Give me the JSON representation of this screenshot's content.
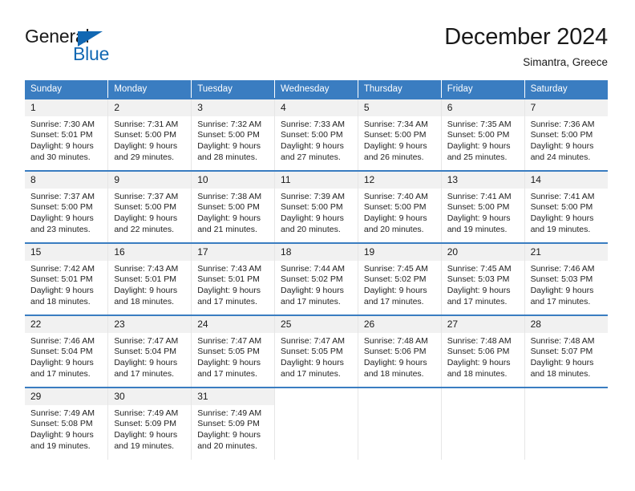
{
  "logo": {
    "word_one": "General",
    "word_two": "Blue",
    "triangle_color": "#1268b3",
    "text_color": "#1a1a1a"
  },
  "header": {
    "title": "December 2024",
    "subtitle": "Simantra, Greece"
  },
  "theme": {
    "header_bg": "#3a7dc1",
    "header_text": "#ffffff",
    "daynum_bg": "#f1f1f1",
    "row_divider": "#3a7dc1",
    "col_divider": "#e6e6e6"
  },
  "weekdays": [
    "Sunday",
    "Monday",
    "Tuesday",
    "Wednesday",
    "Thursday",
    "Friday",
    "Saturday"
  ],
  "weeks": [
    [
      {
        "day": "1",
        "sunrise": "Sunrise: 7:30 AM",
        "sunset": "Sunset: 5:01 PM",
        "daylight_1": "Daylight: 9 hours",
        "daylight_2": "and 30 minutes."
      },
      {
        "day": "2",
        "sunrise": "Sunrise: 7:31 AM",
        "sunset": "Sunset: 5:00 PM",
        "daylight_1": "Daylight: 9 hours",
        "daylight_2": "and 29 minutes."
      },
      {
        "day": "3",
        "sunrise": "Sunrise: 7:32 AM",
        "sunset": "Sunset: 5:00 PM",
        "daylight_1": "Daylight: 9 hours",
        "daylight_2": "and 28 minutes."
      },
      {
        "day": "4",
        "sunrise": "Sunrise: 7:33 AM",
        "sunset": "Sunset: 5:00 PM",
        "daylight_1": "Daylight: 9 hours",
        "daylight_2": "and 27 minutes."
      },
      {
        "day": "5",
        "sunrise": "Sunrise: 7:34 AM",
        "sunset": "Sunset: 5:00 PM",
        "daylight_1": "Daylight: 9 hours",
        "daylight_2": "and 26 minutes."
      },
      {
        "day": "6",
        "sunrise": "Sunrise: 7:35 AM",
        "sunset": "Sunset: 5:00 PM",
        "daylight_1": "Daylight: 9 hours",
        "daylight_2": "and 25 minutes."
      },
      {
        "day": "7",
        "sunrise": "Sunrise: 7:36 AM",
        "sunset": "Sunset: 5:00 PM",
        "daylight_1": "Daylight: 9 hours",
        "daylight_2": "and 24 minutes."
      }
    ],
    [
      {
        "day": "8",
        "sunrise": "Sunrise: 7:37 AM",
        "sunset": "Sunset: 5:00 PM",
        "daylight_1": "Daylight: 9 hours",
        "daylight_2": "and 23 minutes."
      },
      {
        "day": "9",
        "sunrise": "Sunrise: 7:37 AM",
        "sunset": "Sunset: 5:00 PM",
        "daylight_1": "Daylight: 9 hours",
        "daylight_2": "and 22 minutes."
      },
      {
        "day": "10",
        "sunrise": "Sunrise: 7:38 AM",
        "sunset": "Sunset: 5:00 PM",
        "daylight_1": "Daylight: 9 hours",
        "daylight_2": "and 21 minutes."
      },
      {
        "day": "11",
        "sunrise": "Sunrise: 7:39 AM",
        "sunset": "Sunset: 5:00 PM",
        "daylight_1": "Daylight: 9 hours",
        "daylight_2": "and 20 minutes."
      },
      {
        "day": "12",
        "sunrise": "Sunrise: 7:40 AM",
        "sunset": "Sunset: 5:00 PM",
        "daylight_1": "Daylight: 9 hours",
        "daylight_2": "and 20 minutes."
      },
      {
        "day": "13",
        "sunrise": "Sunrise: 7:41 AM",
        "sunset": "Sunset: 5:00 PM",
        "daylight_1": "Daylight: 9 hours",
        "daylight_2": "and 19 minutes."
      },
      {
        "day": "14",
        "sunrise": "Sunrise: 7:41 AM",
        "sunset": "Sunset: 5:00 PM",
        "daylight_1": "Daylight: 9 hours",
        "daylight_2": "and 19 minutes."
      }
    ],
    [
      {
        "day": "15",
        "sunrise": "Sunrise: 7:42 AM",
        "sunset": "Sunset: 5:01 PM",
        "daylight_1": "Daylight: 9 hours",
        "daylight_2": "and 18 minutes."
      },
      {
        "day": "16",
        "sunrise": "Sunrise: 7:43 AM",
        "sunset": "Sunset: 5:01 PM",
        "daylight_1": "Daylight: 9 hours",
        "daylight_2": "and 18 minutes."
      },
      {
        "day": "17",
        "sunrise": "Sunrise: 7:43 AM",
        "sunset": "Sunset: 5:01 PM",
        "daylight_1": "Daylight: 9 hours",
        "daylight_2": "and 17 minutes."
      },
      {
        "day": "18",
        "sunrise": "Sunrise: 7:44 AM",
        "sunset": "Sunset: 5:02 PM",
        "daylight_1": "Daylight: 9 hours",
        "daylight_2": "and 17 minutes."
      },
      {
        "day": "19",
        "sunrise": "Sunrise: 7:45 AM",
        "sunset": "Sunset: 5:02 PM",
        "daylight_1": "Daylight: 9 hours",
        "daylight_2": "and 17 minutes."
      },
      {
        "day": "20",
        "sunrise": "Sunrise: 7:45 AM",
        "sunset": "Sunset: 5:03 PM",
        "daylight_1": "Daylight: 9 hours",
        "daylight_2": "and 17 minutes."
      },
      {
        "day": "21",
        "sunrise": "Sunrise: 7:46 AM",
        "sunset": "Sunset: 5:03 PM",
        "daylight_1": "Daylight: 9 hours",
        "daylight_2": "and 17 minutes."
      }
    ],
    [
      {
        "day": "22",
        "sunrise": "Sunrise: 7:46 AM",
        "sunset": "Sunset: 5:04 PM",
        "daylight_1": "Daylight: 9 hours",
        "daylight_2": "and 17 minutes."
      },
      {
        "day": "23",
        "sunrise": "Sunrise: 7:47 AM",
        "sunset": "Sunset: 5:04 PM",
        "daylight_1": "Daylight: 9 hours",
        "daylight_2": "and 17 minutes."
      },
      {
        "day": "24",
        "sunrise": "Sunrise: 7:47 AM",
        "sunset": "Sunset: 5:05 PM",
        "daylight_1": "Daylight: 9 hours",
        "daylight_2": "and 17 minutes."
      },
      {
        "day": "25",
        "sunrise": "Sunrise: 7:47 AM",
        "sunset": "Sunset: 5:05 PM",
        "daylight_1": "Daylight: 9 hours",
        "daylight_2": "and 17 minutes."
      },
      {
        "day": "26",
        "sunrise": "Sunrise: 7:48 AM",
        "sunset": "Sunset: 5:06 PM",
        "daylight_1": "Daylight: 9 hours",
        "daylight_2": "and 18 minutes."
      },
      {
        "day": "27",
        "sunrise": "Sunrise: 7:48 AM",
        "sunset": "Sunset: 5:06 PM",
        "daylight_1": "Daylight: 9 hours",
        "daylight_2": "and 18 minutes."
      },
      {
        "day": "28",
        "sunrise": "Sunrise: 7:48 AM",
        "sunset": "Sunset: 5:07 PM",
        "daylight_1": "Daylight: 9 hours",
        "daylight_2": "and 18 minutes."
      }
    ],
    [
      {
        "day": "29",
        "sunrise": "Sunrise: 7:49 AM",
        "sunset": "Sunset: 5:08 PM",
        "daylight_1": "Daylight: 9 hours",
        "daylight_2": "and 19 minutes."
      },
      {
        "day": "30",
        "sunrise": "Sunrise: 7:49 AM",
        "sunset": "Sunset: 5:09 PM",
        "daylight_1": "Daylight: 9 hours",
        "daylight_2": "and 19 minutes."
      },
      {
        "day": "31",
        "sunrise": "Sunrise: 7:49 AM",
        "sunset": "Sunset: 5:09 PM",
        "daylight_1": "Daylight: 9 hours",
        "daylight_2": "and 20 minutes."
      },
      null,
      null,
      null,
      null
    ]
  ]
}
